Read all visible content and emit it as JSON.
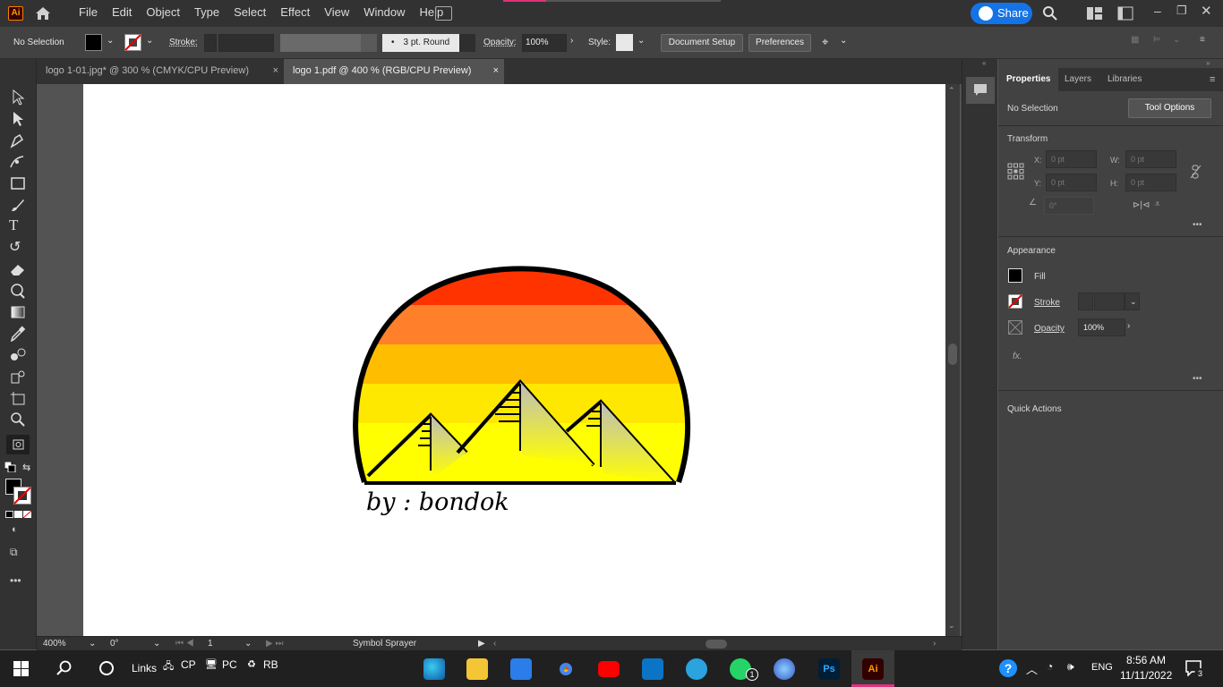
{
  "menubar": {
    "app_logo": "Ai",
    "items": [
      "File",
      "Edit",
      "Object",
      "Type",
      "Select",
      "Effect",
      "View",
      "Window",
      "Help"
    ],
    "share_label": "Share"
  },
  "control": {
    "selection": "No Selection",
    "stroke_label": "Stroke:",
    "brush_label": "3 pt. Round",
    "opacity_label": "Opacity:",
    "opacity_value": "100%",
    "style_label": "Style:",
    "doc_setup": "Document Setup",
    "preferences": "Preferences"
  },
  "tabs": [
    {
      "label": "logo 1-01.jpg* @ 300 % (CMYK/CPU Preview)",
      "close": "×"
    },
    {
      "label": "logo 1.pdf @ 400 % (RGB/CPU Preview)",
      "close": "×"
    }
  ],
  "artwork": {
    "caption": "by : bondok",
    "stripes": [
      "#ff3300",
      "#ff7f2a",
      "#ffbd00",
      "#ffe800",
      "#ffff00"
    ]
  },
  "status": {
    "zoom": "400%",
    "angle": "0°",
    "artboard": "1",
    "tool": "Symbol Sprayer"
  },
  "panel": {
    "tabs": [
      "Properties",
      "Layers",
      "Libraries"
    ],
    "no_selection": "No Selection",
    "tool_options": "Tool Options",
    "transform": "Transform",
    "x_label": "X:",
    "y_label": "Y:",
    "w_label": "W:",
    "h_label": "H:",
    "x_value": "0 pt",
    "y_value": "0 pt",
    "w_value": "0 pt",
    "h_value": "0 pt",
    "angle_value": "0°",
    "appearance": "Appearance",
    "fill": "Fill",
    "stroke": "Stroke",
    "opacity": "Opacity",
    "opacity_value": "100%",
    "fx": "fx.",
    "quick_actions": "Quick Actions",
    "more": "•••"
  },
  "taskbar": {
    "links": "Links",
    "cp": "CP",
    "pc": "PC",
    "rb": "RB",
    "whatsapp_badge": "1",
    "lang": "ENG",
    "time": "8:56 AM",
    "date": "11/11/2022",
    "notif_count": "3",
    "ps": "Ps",
    "ai": "Ai"
  }
}
